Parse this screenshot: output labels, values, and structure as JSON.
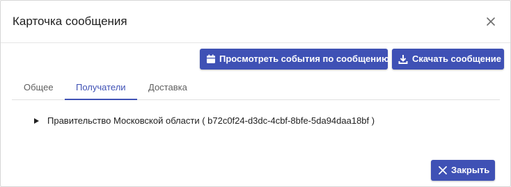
{
  "dialog": {
    "title": "Карточка сообщения",
    "close_icon": "close-icon"
  },
  "actions": {
    "view_events_label": "Просмотреть события по сообщению",
    "view_events_icon": "calendar-icon",
    "download_label": "Скачать сообщение",
    "download_icon": "download-icon"
  },
  "tabs": [
    {
      "label": "Общее",
      "active": false
    },
    {
      "label": "Получатели",
      "active": true
    },
    {
      "label": "Доставка",
      "active": false
    }
  ],
  "recipients": [
    {
      "label": "Правительство Московской области ( b72c0f24-d3dc-4cbf-8bfe-5da94daa18bf )",
      "icon": "expand-caret-icon"
    }
  ],
  "footer": {
    "close_label": "Закрыть",
    "close_icon": "close-icon"
  },
  "colors": {
    "accent": "#3f51b5",
    "text": "#212121",
    "muted": "#5f5f5f"
  }
}
